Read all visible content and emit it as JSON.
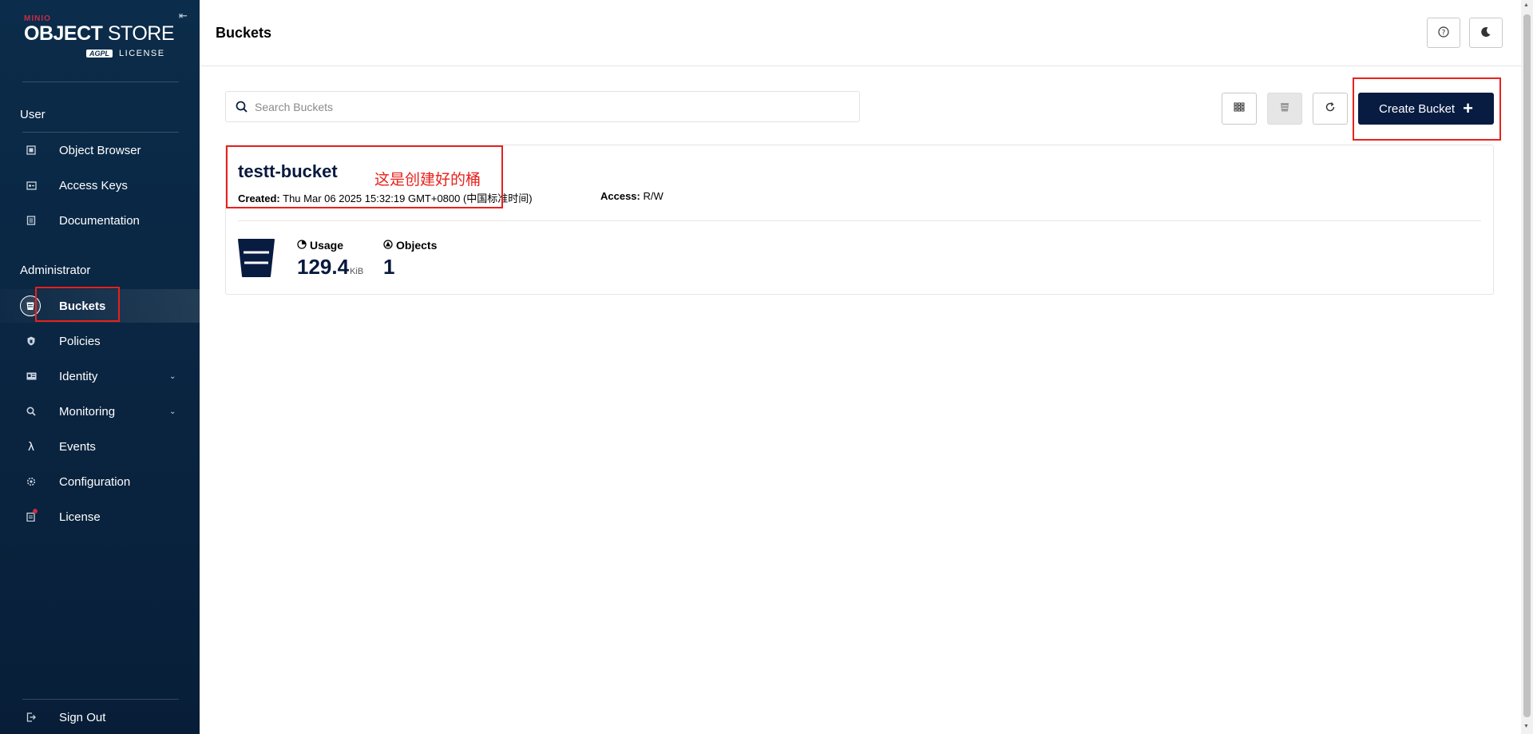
{
  "sidebar": {
    "logo": {
      "brand": "MINIO",
      "title_bold": "OBJECT",
      "title_thin": "STORE",
      "license_badge": "AGPL",
      "license_text": "LICENSE"
    },
    "sections": {
      "user": "User",
      "admin": "Administrator"
    },
    "user_items": [
      {
        "label": "Object Browser",
        "icon": "object-browser-icon"
      },
      {
        "label": "Access Keys",
        "icon": "key-icon"
      },
      {
        "label": "Documentation",
        "icon": "document-icon"
      }
    ],
    "admin_items": [
      {
        "label": "Buckets",
        "icon": "bucket-icon",
        "active": true
      },
      {
        "label": "Policies",
        "icon": "shield-icon"
      },
      {
        "label": "Identity",
        "icon": "id-card-icon",
        "expandable": true
      },
      {
        "label": "Monitoring",
        "icon": "magnifier-icon",
        "expandable": true
      },
      {
        "label": "Events",
        "icon": "lambda-icon"
      },
      {
        "label": "Configuration",
        "icon": "gear-icon"
      },
      {
        "label": "License",
        "icon": "license-icon",
        "notification": true
      }
    ],
    "sign_out": "Sign Out"
  },
  "header": {
    "title": "Buckets"
  },
  "toolbar": {
    "search_placeholder": "Search Buckets",
    "create_label": "Create Bucket"
  },
  "bucket": {
    "name": "testt-bucket",
    "created_label": "Created:",
    "created_value": "Thu Mar 06 2025 15:32:19 GMT+0800 (中国标准时间)",
    "access_label": "Access:",
    "access_value": "R/W",
    "usage_label": "Usage",
    "usage_value": "129.4",
    "usage_unit": "KiB",
    "objects_label": "Objects",
    "objects_value": "1"
  },
  "annotations": {
    "bucket_note": "这是创建好的桶"
  },
  "colors": {
    "sidebar_bg": "#0b2c4a",
    "primary": "#081c42",
    "brand_red": "#c72c48",
    "annotation": "#e8211c"
  }
}
